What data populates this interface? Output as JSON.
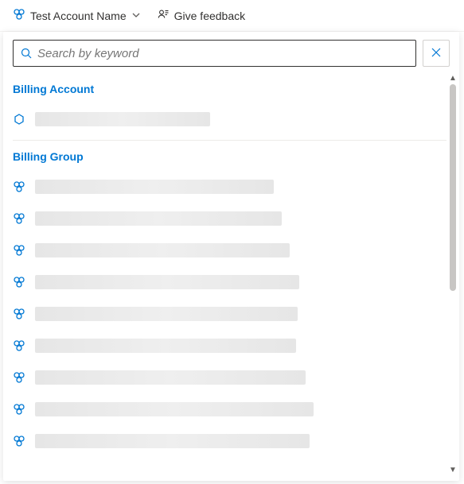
{
  "topbar": {
    "account_label": "Test Account Name",
    "feedback_label": "Give feedback"
  },
  "search": {
    "placeholder": "Search by keyword"
  },
  "sections": {
    "billing_account": {
      "header": "Billing Account",
      "items": [
        {
          "redacted_width": 220
        }
      ]
    },
    "billing_group": {
      "header": "Billing Group",
      "items": [
        {
          "redacted_width": 300
        },
        {
          "redacted_width": 310
        },
        {
          "redacted_width": 320
        },
        {
          "redacted_width": 332
        },
        {
          "redacted_width": 330
        },
        {
          "redacted_width": 328
        },
        {
          "redacted_width": 340
        },
        {
          "redacted_width": 350
        },
        {
          "redacted_width": 345
        }
      ]
    }
  },
  "colors": {
    "accent": "#0078d4"
  }
}
